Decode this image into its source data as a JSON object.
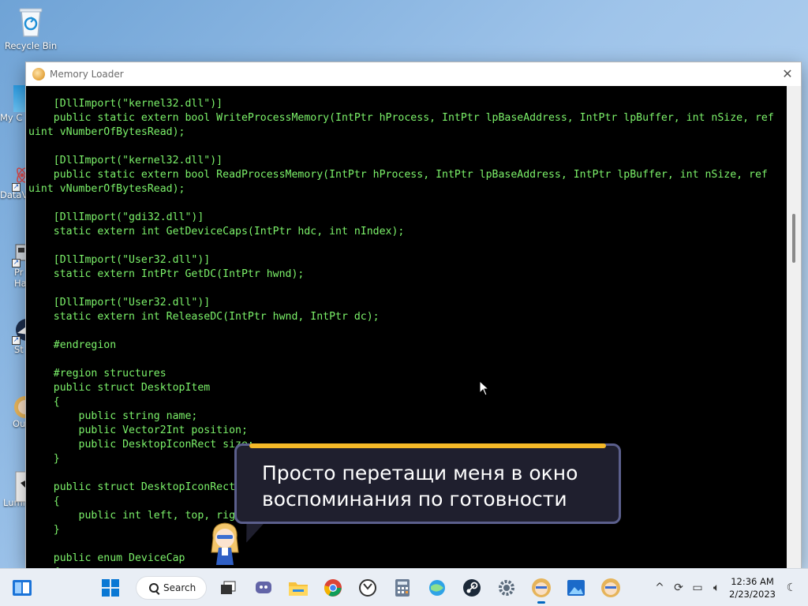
{
  "desktop": {
    "recycle_bin_label": "Recycle Bin",
    "partial_icons": [
      "My C",
      "DataV",
      "Pr Ha",
      "St",
      "Ou",
      "Lumi"
    ]
  },
  "window": {
    "title": "Memory Loader",
    "close_label": "✕",
    "code_lines": [
      "    [DllImport(\"kernel32.dll\")]",
      "    public static extern bool WriteProcessMemory(IntPtr hProcess, IntPtr lpBaseAddress, IntPtr lpBuffer, int nSize, ref",
      "uint vNumberOfBytesRead);",
      "",
      "    [DllImport(\"kernel32.dll\")]",
      "    public static extern bool ReadProcessMemory(IntPtr hProcess, IntPtr lpBaseAddress, IntPtr lpBuffer, int nSize, ref",
      "uint vNumberOfBytesRead);",
      "",
      "    [DllImport(\"gdi32.dll\")]",
      "    static extern int GetDeviceCaps(IntPtr hdc, int nIndex);",
      "",
      "    [DllImport(\"User32.dll\")]",
      "    static extern IntPtr GetDC(IntPtr hwnd);",
      "",
      "    [DllImport(\"User32.dll\")]",
      "    static extern int ReleaseDC(IntPtr hwnd, IntPtr dc);",
      "",
      "    #endregion",
      "",
      "    #region structures",
      "    public struct DesktopItem",
      "    {",
      "        public string name;",
      "        public Vector2Int position;",
      "        public DesktopIconRect size;",
      "    }",
      "",
      "    public struct DesktopIconRect",
      "    {",
      "        public int left, top, right, bottom;",
      "    }",
      "",
      "    public enum DeviceCap",
      "    {"
    ]
  },
  "bubble": {
    "line1": "Просто перетащи меня в окно",
    "line2": "воспоминания по готовности"
  },
  "taskbar": {
    "search_label": "Search",
    "time": "12:36 AM",
    "date": "2/23/2023"
  },
  "colors": {
    "code_text": "#7cf26a",
    "console_bg": "#000000",
    "bubble_bg": "#1f1f2e",
    "bubble_accent": "#f5b928"
  }
}
